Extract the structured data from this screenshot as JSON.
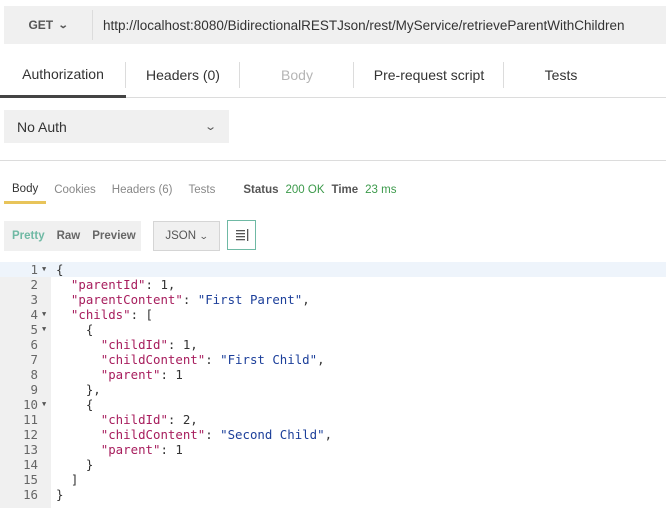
{
  "request": {
    "method": "GET",
    "url": "http://localhost:8080/BidirectionalRESTJson/rest/MyService/retrieveParentWithChildren"
  },
  "request_tabs": [
    "Authorization",
    "Headers (0)",
    "Body",
    "Pre-request script",
    "Tests"
  ],
  "auth": {
    "selected": "No Auth"
  },
  "response_tabs": [
    "Body",
    "Cookies",
    "Headers (6)",
    "Tests"
  ],
  "response_meta": {
    "status_label": "Status",
    "status_value": "200 OK",
    "time_label": "Time",
    "time_value": "23 ms"
  },
  "format_buttons": [
    "Pretty",
    "Raw",
    "Preview"
  ],
  "language_select": "JSON",
  "colors": {
    "accent": "#6fb9a4",
    "tab_underline": "#e8c45a",
    "status_ok": "#3c9a4b"
  },
  "code_lines": [
    {
      "n": "1",
      "fold": true,
      "segs": [
        {
          "t": "{",
          "c": "n"
        }
      ]
    },
    {
      "n": "2",
      "fold": false,
      "segs": [
        {
          "t": "  ",
          "c": "n"
        },
        {
          "t": "\"parentId\"",
          "c": "k"
        },
        {
          "t": ": 1,",
          "c": "n"
        }
      ]
    },
    {
      "n": "3",
      "fold": false,
      "segs": [
        {
          "t": "  ",
          "c": "n"
        },
        {
          "t": "\"parentContent\"",
          "c": "k"
        },
        {
          "t": ": ",
          "c": "n"
        },
        {
          "t": "\"First Parent\"",
          "c": "s"
        },
        {
          "t": ",",
          "c": "n"
        }
      ]
    },
    {
      "n": "4",
      "fold": true,
      "segs": [
        {
          "t": "  ",
          "c": "n"
        },
        {
          "t": "\"childs\"",
          "c": "k"
        },
        {
          "t": ": [",
          "c": "n"
        }
      ]
    },
    {
      "n": "5",
      "fold": true,
      "segs": [
        {
          "t": "    {",
          "c": "n"
        }
      ]
    },
    {
      "n": "6",
      "fold": false,
      "segs": [
        {
          "t": "      ",
          "c": "n"
        },
        {
          "t": "\"childId\"",
          "c": "k"
        },
        {
          "t": ": 1,",
          "c": "n"
        }
      ]
    },
    {
      "n": "7",
      "fold": false,
      "segs": [
        {
          "t": "      ",
          "c": "n"
        },
        {
          "t": "\"childContent\"",
          "c": "k"
        },
        {
          "t": ": ",
          "c": "n"
        },
        {
          "t": "\"First Child\"",
          "c": "s"
        },
        {
          "t": ",",
          "c": "n"
        }
      ]
    },
    {
      "n": "8",
      "fold": false,
      "segs": [
        {
          "t": "      ",
          "c": "n"
        },
        {
          "t": "\"parent\"",
          "c": "k"
        },
        {
          "t": ": 1",
          "c": "n"
        }
      ]
    },
    {
      "n": "9",
      "fold": false,
      "segs": [
        {
          "t": "    },",
          "c": "n"
        }
      ]
    },
    {
      "n": "10",
      "fold": true,
      "segs": [
        {
          "t": "    {",
          "c": "n"
        }
      ]
    },
    {
      "n": "11",
      "fold": false,
      "segs": [
        {
          "t": "      ",
          "c": "n"
        },
        {
          "t": "\"childId\"",
          "c": "k"
        },
        {
          "t": ": 2,",
          "c": "n"
        }
      ]
    },
    {
      "n": "12",
      "fold": false,
      "segs": [
        {
          "t": "      ",
          "c": "n"
        },
        {
          "t": "\"childContent\"",
          "c": "k"
        },
        {
          "t": ": ",
          "c": "n"
        },
        {
          "t": "\"Second Child\"",
          "c": "s"
        },
        {
          "t": ",",
          "c": "n"
        }
      ]
    },
    {
      "n": "13",
      "fold": false,
      "segs": [
        {
          "t": "      ",
          "c": "n"
        },
        {
          "t": "\"parent\"",
          "c": "k"
        },
        {
          "t": ": 1",
          "c": "n"
        }
      ]
    },
    {
      "n": "14",
      "fold": false,
      "segs": [
        {
          "t": "    }",
          "c": "n"
        }
      ]
    },
    {
      "n": "15",
      "fold": false,
      "segs": [
        {
          "t": "  ]",
          "c": "n"
        }
      ]
    },
    {
      "n": "16",
      "fold": false,
      "segs": [
        {
          "t": "}",
          "c": "n"
        }
      ]
    }
  ]
}
